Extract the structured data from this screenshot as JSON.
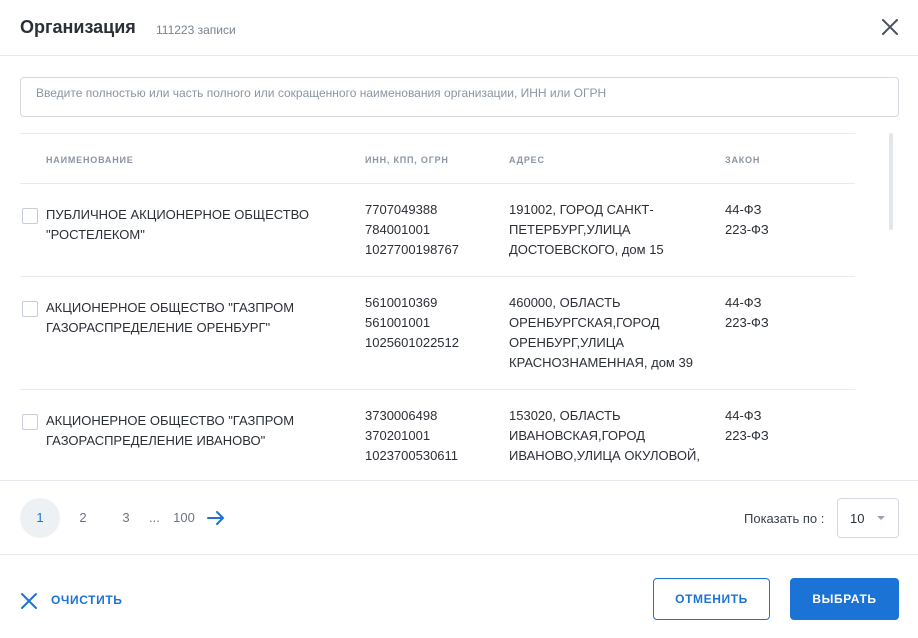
{
  "header": {
    "title": "Организация",
    "count": "111223 записи",
    "close_icon": "close-icon"
  },
  "search": {
    "placeholder": "Введите полностью или часть полного или сокращенного наименования организации, ИНН или ОГРН",
    "value": ""
  },
  "table": {
    "columns": {
      "name": "НАИМЕНОВАНИЕ",
      "ids": "ИНН, КПП, ОГРН",
      "address": "АДРЕС",
      "law": "ЗАКОН"
    },
    "rows": [
      {
        "checked": false,
        "name": [
          "ПУБЛИЧНОЕ АКЦИОНЕРНОЕ ОБЩЕСТВО",
          "\"РОСТЕЛЕКОМ\""
        ],
        "inn": "7707049388",
        "kpp": "784001001",
        "ogrn": "1027700198767",
        "address": [
          "191002, ГОРОД САНКТ-",
          "ПЕТЕРБУРГ,УЛИЦА",
          "ДОСТОЕВСКОГО, дом 15"
        ],
        "law": [
          "44-ФЗ",
          "223-ФЗ"
        ]
      },
      {
        "checked": false,
        "name": [
          "АКЦИОНЕРНОЕ ОБЩЕСТВО \"ГАЗПРОМ",
          "ГАЗОРАСПРЕДЕЛЕНИЕ ОРЕНБУРГ\""
        ],
        "inn": "5610010369",
        "kpp": "561001001",
        "ogrn": "1025601022512",
        "address": [
          "460000, ОБЛАСТЬ",
          "ОРЕНБУРГСКАЯ,ГОРОД",
          "ОРЕНБУРГ,УЛИЦА",
          "КРАСНОЗНАМЕННАЯ, дом 39"
        ],
        "law": [
          "44-ФЗ",
          "223-ФЗ"
        ]
      },
      {
        "checked": false,
        "name": [
          "АКЦИОНЕРНОЕ ОБЩЕСТВО \"ГАЗПРОМ",
          "ГАЗОРАСПРЕДЕЛЕНИЕ ИВАНОВО\""
        ],
        "inn": "3730006498",
        "kpp": "370201001",
        "ogrn": "1023700530611",
        "address": [
          "153020, ОБЛАСТЬ",
          "ИВАНОВСКАЯ,ГОРОД",
          "ИВАНОВО,УЛИЦА ОКУЛОВОЙ,"
        ],
        "law": [
          "44-ФЗ",
          "223-ФЗ"
        ]
      }
    ]
  },
  "pagination": {
    "pages": [
      "1",
      "2",
      "3"
    ],
    "active": "1",
    "ellipsis": "...",
    "last": "100",
    "next_icon": "arrow-right-icon",
    "show_label": "Показать по :",
    "per_page": "10"
  },
  "footer": {
    "clear_label": "ОЧИСТИТЬ",
    "cancel_label": "ОТМЕНИТЬ",
    "select_label": "ВЫБРАТЬ"
  },
  "colors": {
    "accent": "#1b73d6",
    "text": "#2b2f36",
    "muted": "#8b95a3",
    "border": "#e7eaee"
  }
}
